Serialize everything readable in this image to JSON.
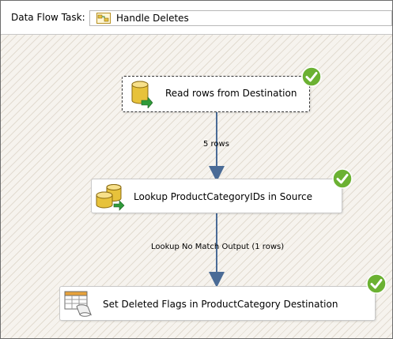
{
  "toolbar": {
    "label": "Data Flow Task:",
    "task_name": "Handle Deletes",
    "task_icon": "data-flow-task-icon"
  },
  "components": [
    {
      "label": "Read rows from Destination",
      "icon": "database-source-icon",
      "status": "success"
    },
    {
      "label": "Lookup ProductCategoryIDs in Source",
      "icon": "lookup-database-icon",
      "status": "success"
    },
    {
      "label": "Set Deleted Flags in ProductCategory Destination",
      "icon": "ole-db-command-icon",
      "status": "success"
    }
  ],
  "paths": [
    {
      "label": "5 rows"
    },
    {
      "label": "Lookup No Match Output (1 rows)"
    }
  ],
  "colors": {
    "success": "#6bb132",
    "path_arrow": "#4a6b96",
    "database": "#e7c23b"
  }
}
